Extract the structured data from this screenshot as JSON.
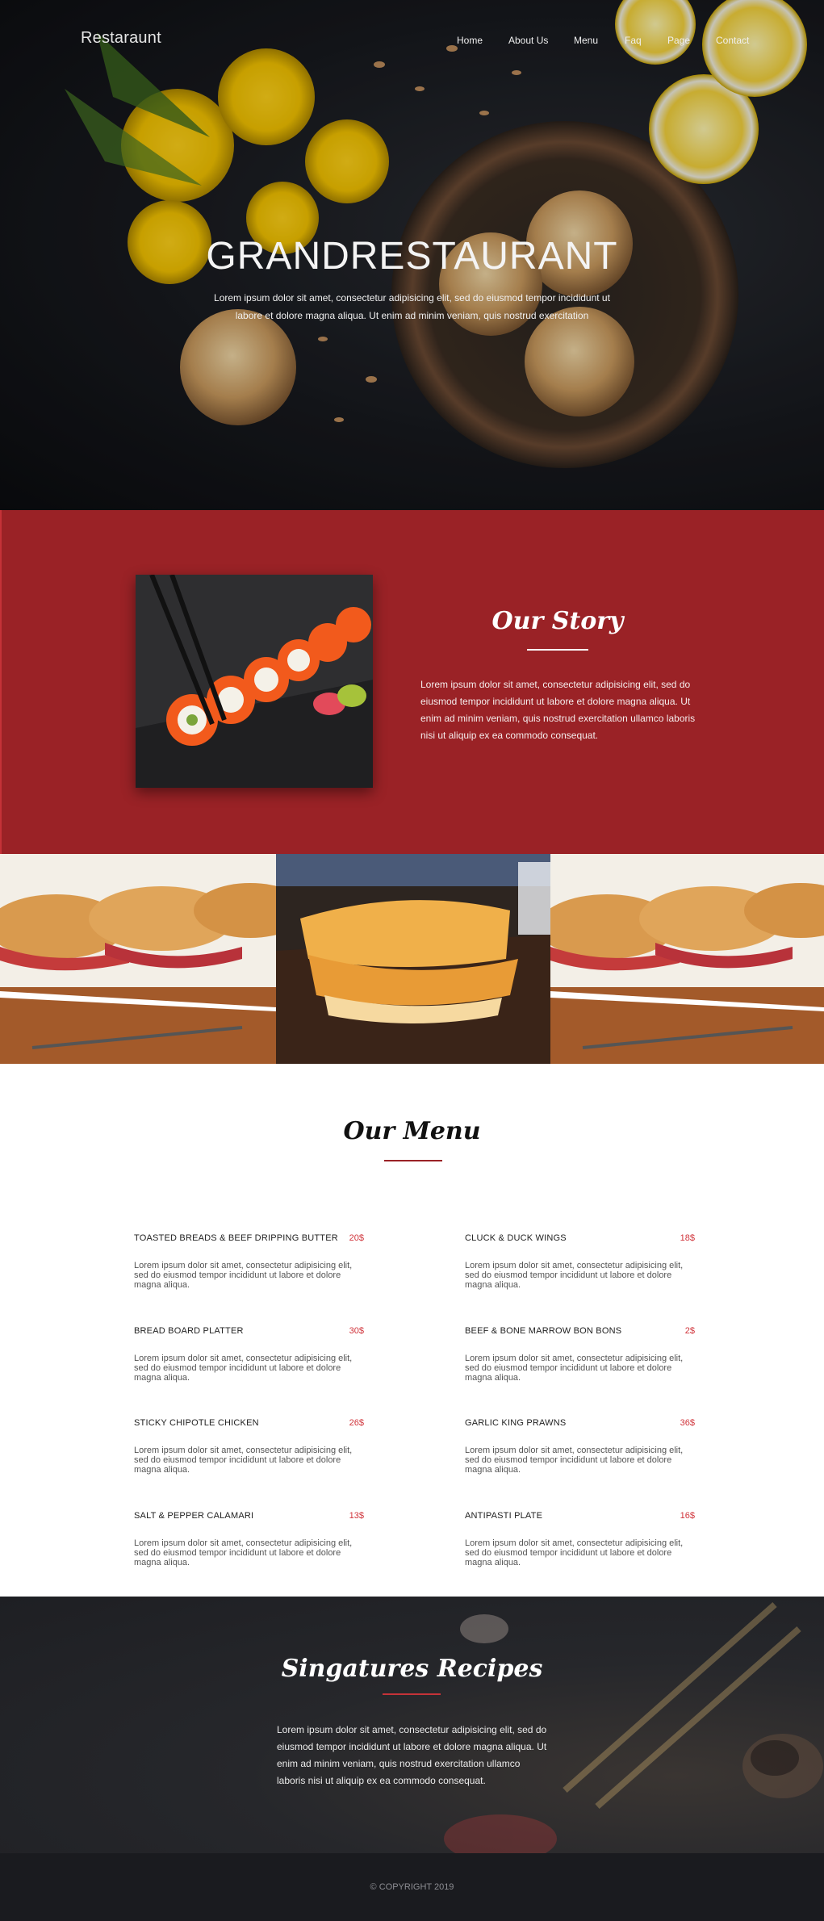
{
  "brand": "Restaraunt",
  "nav": {
    "items": [
      {
        "label": "Home"
      },
      {
        "label": "About Us"
      },
      {
        "label": "Menu"
      },
      {
        "label": "Faq"
      },
      {
        "label": "Page"
      },
      {
        "label": "Contact"
      }
    ]
  },
  "hero": {
    "title": "GRANDRESTAURANT",
    "subtitle": "Lorem ipsum dolor sit amet, consectetur adipisicing elit, sed do eiusmod tempor incididunt ut labore et dolore magna aliqua. Ut enim ad minim veniam, quis nostrud exercitation"
  },
  "story": {
    "title": "Our Story",
    "text": "Lorem ipsum dolor sit amet, consectetur adipisicing elit, sed do eiusmod tempor incididunt ut labore et dolore magna aliqua. Ut enim ad minim veniam, quis nostrud exercitation ullamco laboris nisi ut aliquip ex ea commodo consequat."
  },
  "menu": {
    "title": "Our Menu",
    "dishes": [
      {
        "name": "TOASTED BREADS & BEEF DRIPPING BUTTER",
        "price": "20$",
        "desc": "Lorem ipsum dolor sit amet, consectetur adipisicing elit, sed do eiusmod tempor incididunt ut labore et dolore magna aliqua."
      },
      {
        "name": "CLUCK & DUCK WINGS",
        "price": "18$",
        "desc": "Lorem ipsum dolor sit amet, consectetur adipisicing elit, sed do eiusmod tempor incididunt ut labore et dolore magna aliqua."
      },
      {
        "name": "BREAD BOARD PLATTER",
        "price": "30$",
        "desc": "Lorem ipsum dolor sit amet, consectetur adipisicing elit, sed do eiusmod tempor incididunt ut labore et dolore magna aliqua."
      },
      {
        "name": "BEEF & BONE MARROW BON BONS",
        "price": "2$",
        "desc": "Lorem ipsum dolor sit amet, consectetur adipisicing elit, sed do eiusmod tempor incididunt ut labore et dolore magna aliqua."
      },
      {
        "name": "STICKY CHIPOTLE CHICKEN",
        "price": "26$",
        "desc": "Lorem ipsum dolor sit amet, consectetur adipisicing elit, sed do eiusmod tempor incididunt ut labore et dolore magna aliqua."
      },
      {
        "name": "GARLIC KING PRAWNS",
        "price": "36$",
        "desc": "Lorem ipsum dolor sit amet, consectetur adipisicing elit, sed do eiusmod tempor incididunt ut labore et dolore magna aliqua."
      },
      {
        "name": "SALT & PEPPER CALAMARI",
        "price": "13$",
        "desc": "Lorem ipsum dolor sit amet, consectetur adipisicing elit, sed do eiusmod tempor incididunt ut labore et dolore magna aliqua."
      },
      {
        "name": "ANTIPASTI PLATE",
        "price": "16$",
        "desc": "Lorem ipsum dolor sit amet, consectetur adipisicing elit, sed do eiusmod tempor incididunt ut labore et dolore magna aliqua."
      }
    ]
  },
  "signature": {
    "title": "Singatures Recipes",
    "text": "Lorem ipsum dolor sit amet, consectetur adipisicing elit, sed do eiusmod tempor incididunt ut labore et dolore magna aliqua. Ut enim ad minim veniam, quis nostrud exercitation ullamco laboris nisi ut aliquip ex ea commodo consequat."
  },
  "footer": {
    "copyright": "© COPYRIGHT 2019"
  },
  "colors": {
    "accent_red": "#9a2226",
    "price_red": "#d0333a",
    "hero_dark": "#17191e",
    "footer_dark": "#1a1b1f"
  }
}
